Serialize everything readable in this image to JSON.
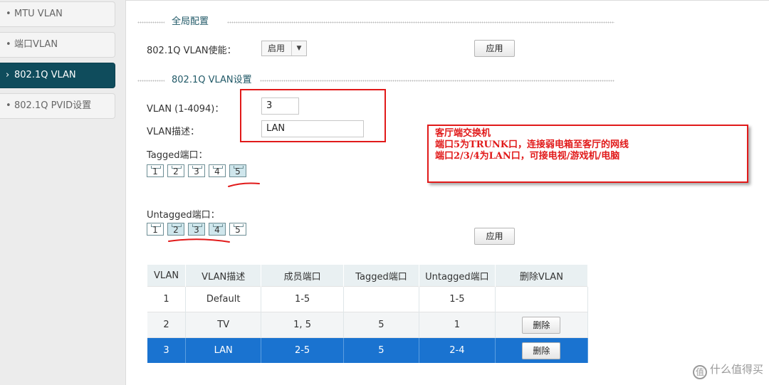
{
  "sidebar": {
    "items": [
      {
        "label": "MTU VLAN",
        "bullet": "•"
      },
      {
        "label": "端口VLAN",
        "bullet": "•"
      },
      {
        "label": "802.1Q VLAN",
        "bullet": "›"
      },
      {
        "label": "802.1Q PVID设置",
        "bullet": "•"
      }
    ]
  },
  "global": {
    "title": "全局配置",
    "enable_label": "802.1Q VLAN使能：",
    "enable_value": "启用",
    "apply_label": "应用"
  },
  "vlan_settings": {
    "title": "802.1Q VLAN设置",
    "vlan_id_label": "VLAN (1-4094)：",
    "vlan_id_value": "3",
    "desc_label": "VLAN描述：",
    "desc_value": "LAN",
    "tagged_label": "Tagged端口：",
    "untagged_label": "Untagged端口：",
    "tagged_ports": [
      {
        "num": "1",
        "selected": false
      },
      {
        "num": "2",
        "selected": false
      },
      {
        "num": "3",
        "selected": false
      },
      {
        "num": "4",
        "selected": false
      },
      {
        "num": "5",
        "selected": true
      }
    ],
    "untagged_ports": [
      {
        "num": "1",
        "selected": false
      },
      {
        "num": "2",
        "selected": true
      },
      {
        "num": "3",
        "selected": true
      },
      {
        "num": "4",
        "selected": true
      },
      {
        "num": "5",
        "selected": false
      }
    ],
    "apply_label": "应用"
  },
  "table": {
    "headers": [
      "VLAN",
      "VLAN描述",
      "成员端口",
      "Tagged端口",
      "Untagged端口",
      "删除VLAN"
    ],
    "rows": [
      [
        "1",
        "Default",
        "1-5",
        "",
        "1-5",
        ""
      ],
      [
        "2",
        "TV",
        "1, 5",
        "5",
        "1",
        "删除"
      ],
      [
        "3",
        "LAN",
        "2-5",
        "5",
        "2-4",
        "删除"
      ]
    ]
  },
  "annotation": {
    "lines": [
      "客厅端交换机",
      "端口5为TRUNK口，连接弱电箱至客厅的网线",
      "端口2/3/4为LAN口，可接电视/游戏机/电脑"
    ]
  },
  "watermark": {
    "text": "什么值得买",
    "icon": "值"
  },
  "colors": {
    "sidebar_active": "#0f4c5c",
    "annotation_red": "#e11a1a",
    "selected_row": "#1a73d0"
  }
}
